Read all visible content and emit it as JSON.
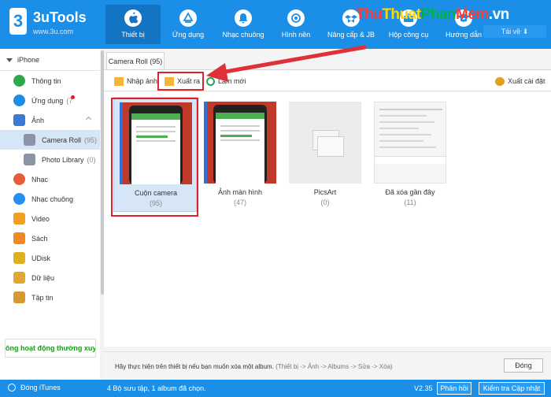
{
  "app": {
    "logo_char": "3",
    "brand": "3uTools",
    "url": "www.3u.com",
    "download_label": "Tải về"
  },
  "watermark": {
    "part1": "Thu",
    "part2": "Thuat",
    "part3": "Phan",
    "part4": "Mem",
    "part5": ".vn"
  },
  "nav": [
    {
      "label": "Thiết bị",
      "icon": "apple-icon"
    },
    {
      "label": "Ứng dụng",
      "icon": "app-store-icon"
    },
    {
      "label": "Nhạc chuông",
      "icon": "bell-icon"
    },
    {
      "label": "Hình nền",
      "icon": "flower-icon"
    },
    {
      "label": "Nâng cấp & JB",
      "icon": "dropbox-icon"
    },
    {
      "label": "Hộp công cụ",
      "icon": "toolbox-icon"
    },
    {
      "label": "Hướng dẫn",
      "icon": "graduation-cap-icon"
    }
  ],
  "sidebar": {
    "device": "iPhone",
    "items": [
      {
        "label": "Thông tin",
        "count": "",
        "color": "#2ea84a"
      },
      {
        "label": "Ứng dụng",
        "count": "(7",
        "color": "#1b8fe8"
      },
      {
        "label": "Ảnh",
        "count": "",
        "color": "#3a7bd5"
      },
      {
        "label": "Camera Roll",
        "count": "(95)",
        "color": "#8a94a6"
      },
      {
        "label": "Photo Library",
        "count": "(0)",
        "color": "#8a94a6"
      },
      {
        "label": "Nhạc",
        "count": "",
        "color": "#e85c3a"
      },
      {
        "label": "Nhạc chuông",
        "count": "",
        "color": "#2a8ef0"
      },
      {
        "label": "Video",
        "count": "",
        "color": "#f0a020"
      },
      {
        "label": "Sách",
        "count": "",
        "color": "#f08a20"
      },
      {
        "label": "UDisk",
        "count": "",
        "color": "#e0b020"
      },
      {
        "label": "Dữ liệu",
        "count": "",
        "color": "#e0a830"
      },
      {
        "label": "Tập tin",
        "count": "",
        "color": "#d89a30"
      }
    ],
    "status": "ông hoạt động thường xuyê"
  },
  "main": {
    "tab": "Camera Roll (95)",
    "toolbar": {
      "import": "Nhập ảnh",
      "export": "Xuất ra",
      "refresh": "Làm mới",
      "export_settings": "Xuất cài đặt"
    },
    "albums": [
      {
        "name": "Cuộn camera",
        "count": "(95)"
      },
      {
        "name": "Ảnh màn hình",
        "count": "(47)"
      },
      {
        "name": "PicsArt",
        "count": "(0)"
      },
      {
        "name": "Đã xóa gần đây",
        "count": "(11)"
      }
    ],
    "hint": "Hãy thực hiện trên thiết bị nếu bạn muốn xóa một album.",
    "hint_path": "(Thiết bị -> Ảnh -> Albums -> Sửa -> Xóa)",
    "close": "Đóng"
  },
  "footer": {
    "itunes": "Đóng iTunes",
    "info": "4 Bộ sưu tập, 1 album đã chọn.",
    "version": "V2.35",
    "feedback": "Phản hồi",
    "check_update": "Kiểm tra Cập nhật"
  }
}
